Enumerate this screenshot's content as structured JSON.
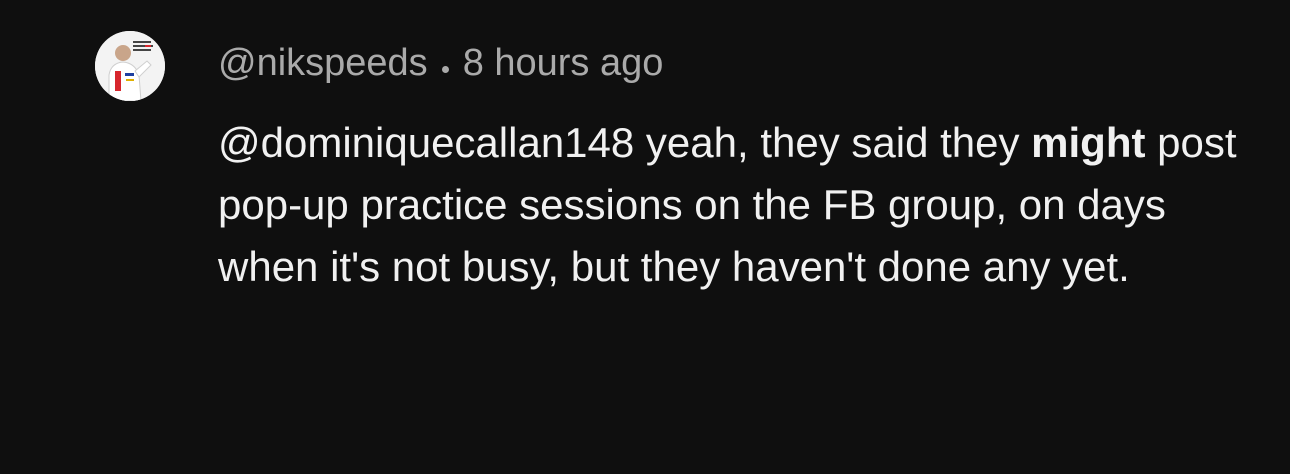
{
  "comment": {
    "author": "@nikspeeds",
    "timestamp": "8 hours ago",
    "avatar_icon": "avatar-poster-icon",
    "avatar_text": "IF YOU AIN'T FIRST YOU'RE LAST",
    "body": {
      "mention": "@dominiquecallan148",
      "text_before_bold": " yeah, they said they ",
      "bold": "might",
      "text_after_bold": " post pop-up practice sessions on the FB group, on days when it's not busy, but they haven't done any yet."
    }
  },
  "colors": {
    "background": "#0f0f0f",
    "meta_text": "#aaaaaa",
    "body_text": "#f1f1f1",
    "accent_red": "#d7262d"
  }
}
